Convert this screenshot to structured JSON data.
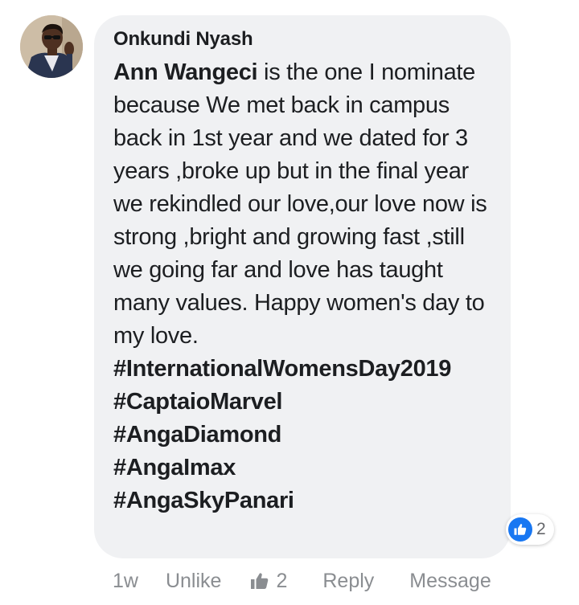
{
  "comment": {
    "author": "Onkundi Nyash",
    "mention": "Ann Wangeci",
    "body": " is the one I nominate because We met back in campus back in 1st year and we dated for 3 years ,broke up but in the final year we rekindled our love,our love now is strong ,bright and growing fast ,still we going far and love has taught many values. Happy women's day to my love.",
    "hashtags": [
      "#InternationalWomensDay2019",
      "#CaptaioMarvel",
      "#AngaDiamond",
      "#AngaImax",
      "#AngaSkyPanari"
    ],
    "reaction_count": "2",
    "reaction_icon": "like-icon",
    "colors": {
      "bubble": "#f0f1f3",
      "like_blue": "#1877f2",
      "meta_gray": "#8a8d91"
    }
  },
  "actions": {
    "time": "1w",
    "unlike": "Unlike",
    "like_count": "2",
    "reply": "Reply",
    "message": "Message"
  }
}
